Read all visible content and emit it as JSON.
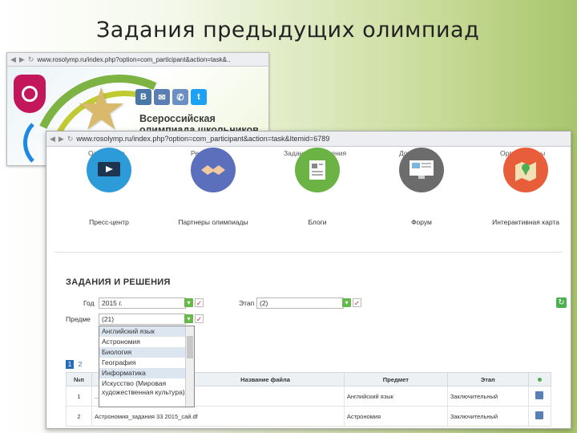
{
  "slide": {
    "title": "Задания предыдущих олимпиад"
  },
  "back_screenshot": {
    "url": "www.rosolymp.ru/index.php?option=com_participant&action=task&..",
    "banner_text": [
      "Всероссийская",
      "олимпиада школьников"
    ],
    "social": [
      {
        "icon": "vk-icon",
        "glyph": "B",
        "color": "#4a76a8"
      },
      {
        "icon": "mail-icon",
        "glyph": "✉",
        "color": "#5b7fb5"
      },
      {
        "icon": "phone-icon",
        "glyph": "✆",
        "color": "#6b8fc5"
      },
      {
        "icon": "twitter-icon",
        "glyph": "t",
        "color": "#1da1f2"
      }
    ]
  },
  "front_screenshot": {
    "url": "www.rosolymp.ru/index.php?option=com_participant&action=task&Itemid=6789",
    "top_menu": [
      "Олимпиада",
      "Результаты",
      "Задания и решения",
      "Документы",
      "Организаторы"
    ],
    "tiles": [
      {
        "label": "Пресс-центр",
        "icon": "tv-icon",
        "color": "#2d9bd8"
      },
      {
        "label": "Партнеры олимпиады",
        "icon": "handshake-icon",
        "color": "#5b6fbd"
      },
      {
        "label": "Блоги",
        "icon": "document-icon",
        "color": "#6ab344"
      },
      {
        "label": "Форум",
        "icon": "monitor-icon",
        "color": "#6c6c6c"
      },
      {
        "label": "Интерактивная карта",
        "icon": "map-pin-icon",
        "color": "#e85e3a"
      }
    ],
    "section_title": "ЗАДАНИЯ И РЕШЕНИЯ",
    "filters": {
      "year_label": "Год",
      "year_value": "2015 г.",
      "stage_label": "Этап",
      "stage_value": "(2)",
      "subject_label": "Предме",
      "subject_value": "(21)"
    },
    "dropdown_options": [
      {
        "text": "Английский язык",
        "highlight": true
      },
      {
        "text": "Астрономия",
        "highlight": false
      },
      {
        "text": "Биология",
        "highlight": true
      },
      {
        "text": "География",
        "highlight": false
      },
      {
        "text": "Информатика",
        "highlight": true
      },
      {
        "text": "Искусство (Мировая художественная культура)",
        "highlight": false
      }
    ],
    "pager": [
      "1",
      "2"
    ],
    "table": {
      "headers": [
        "№п",
        "",
        "Название файла",
        "Предмет",
        "Этап",
        ""
      ],
      "rows": [
        {
          "num": "1",
          "file": "...df",
          "subject": "Английский язык",
          "stage": "Заключительный"
        },
        {
          "num": "2",
          "file": "Астрономия_задания 33 2015_сай.df",
          "subject": "Астрономия",
          "stage": "Заключительный"
        }
      ]
    }
  }
}
